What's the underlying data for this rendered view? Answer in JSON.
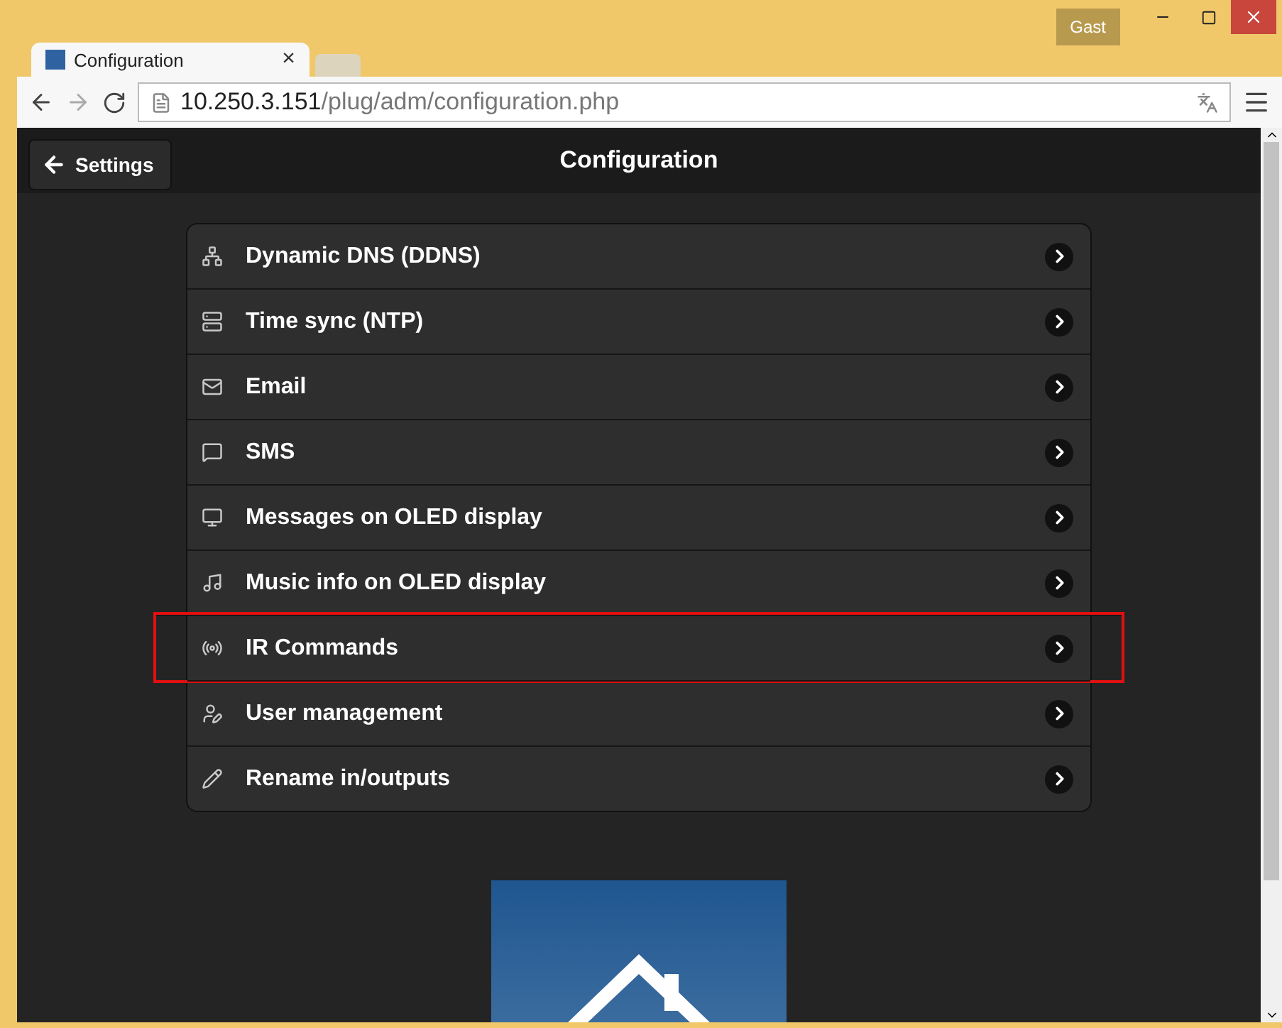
{
  "window": {
    "user": "Gast"
  },
  "tab": {
    "title": "Configuration",
    "close": "×"
  },
  "address_bar": {
    "host": "10.250.3.151",
    "path": "/plug/adm/configuration.php"
  },
  "header": {
    "back_button": "Settings",
    "title": "Configuration"
  },
  "menu": [
    {
      "label": "Dynamic DNS (DDNS)",
      "highlighted": false
    },
    {
      "label": "Time sync (NTP)",
      "highlighted": false
    },
    {
      "label": "Email",
      "highlighted": false
    },
    {
      "label": "SMS",
      "highlighted": false
    },
    {
      "label": "Messages on OLED display",
      "highlighted": false
    },
    {
      "label": "Music info on OLED display",
      "highlighted": false
    },
    {
      "label": "IR Commands",
      "highlighted": true
    },
    {
      "label": "User management",
      "highlighted": false
    },
    {
      "label": "Rename in/outputs",
      "highlighted": false
    }
  ]
}
